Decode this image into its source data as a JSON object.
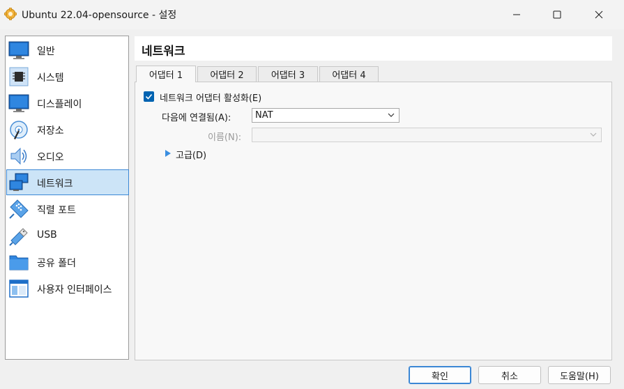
{
  "window": {
    "title": "Ubuntu 22.04-opensource - 설정"
  },
  "sidebar": {
    "items": [
      {
        "label": "일반",
        "icon": "general-monitor-icon"
      },
      {
        "label": "시스템",
        "icon": "system-chip-icon"
      },
      {
        "label": "디스플레이",
        "icon": "display-monitor-icon"
      },
      {
        "label": "저장소",
        "icon": "storage-disk-icon"
      },
      {
        "label": "오디오",
        "icon": "audio-speaker-icon"
      },
      {
        "label": "네트워크",
        "icon": "network-icon",
        "selected": true
      },
      {
        "label": "직렬 포트",
        "icon": "serial-port-icon"
      },
      {
        "label": "USB",
        "icon": "usb-icon"
      },
      {
        "label": "공유 폴더",
        "icon": "shared-folder-icon"
      },
      {
        "label": "사용자 인터페이스",
        "icon": "user-interface-icon"
      }
    ]
  },
  "page": {
    "title": "네트워크"
  },
  "tabs": [
    {
      "label": "어댑터 1",
      "active": true
    },
    {
      "label": "어댑터 2"
    },
    {
      "label": "어댑터 3"
    },
    {
      "label": "어댑터 4"
    }
  ],
  "adapter": {
    "enable_label": "네트워크 어댑터 활성화(E)",
    "enabled": true,
    "attached_label": "다음에 연결됨(A):",
    "attached_value": "NAT",
    "name_label": "이름(N):",
    "name_value": "",
    "advanced_label": "고급(D)"
  },
  "buttons": {
    "ok": "확인",
    "cancel": "취소",
    "help": "도움말(H)"
  },
  "colors": {
    "accent": "#0063b1",
    "selection_bg": "#cce4f7",
    "selection_border": "#3b87d5"
  }
}
